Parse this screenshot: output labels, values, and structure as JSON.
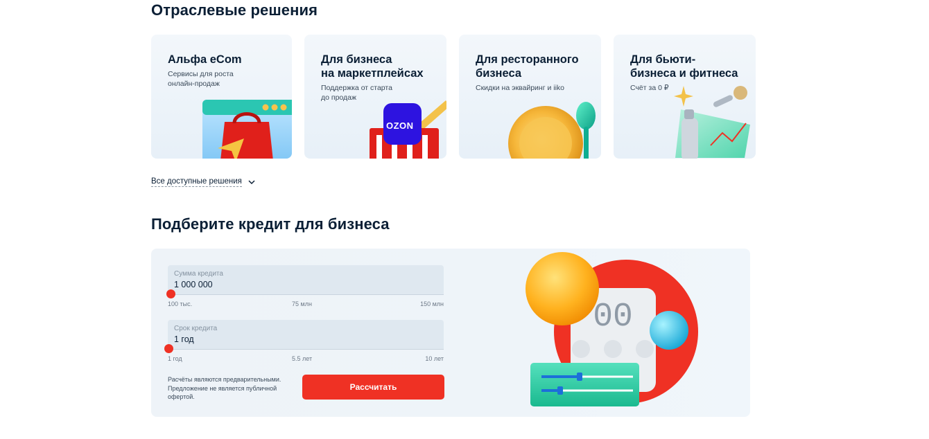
{
  "industry": {
    "title": "Отраслевые решения",
    "cards": [
      {
        "title": "Альфа eCom",
        "subtitle": "Сервисы для роста\nонлайн-продаж"
      },
      {
        "title": "Для бизнеса\nна маркетплейсах",
        "subtitle": "Поддержка от старта\nдо продаж",
        "logo_text": "OZON"
      },
      {
        "title": "Для ресторанного\nбизнеса",
        "subtitle": "Скидки на эквайринг и iiko"
      },
      {
        "title": "Для бьюти-\nбизнеса и фитнеса",
        "subtitle": "Счёт за 0 ₽"
      }
    ],
    "all_link": "Все доступные решения",
    "all_link_icon": "chevron-down-icon"
  },
  "credit": {
    "title": "Подберите кредит для бизнеса",
    "amount": {
      "label": "Сумма кредита",
      "value": "1 000 000",
      "slider_level": 0,
      "ticks": [
        "100 тыс.",
        "75 млн",
        "150 млн"
      ]
    },
    "term": {
      "label": "Срок кредита",
      "value": "1 год",
      "slider_level": 0,
      "ticks": [
        "1 год",
        "5.5 лет",
        "10 лет"
      ]
    },
    "disclaimer": "Расчёты являются предварительными.\nПредложение не является публичной\nофертой.",
    "calculate_label": "Рассчитать",
    "display_digits": "00"
  },
  "colors": {
    "accent": "#ef3124",
    "text": "#0b1f35",
    "card_bg": "#eef3f8"
  }
}
